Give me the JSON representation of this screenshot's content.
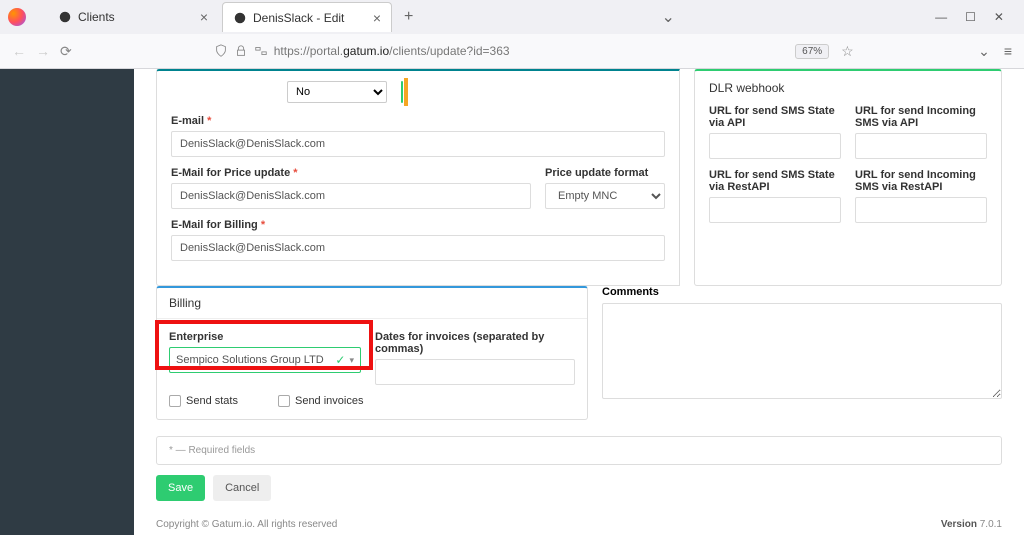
{
  "tabs": [
    {
      "title": "Clients"
    },
    {
      "title": "DenisSlack - Edit"
    }
  ],
  "url": {
    "prefix": "https://portal.",
    "domain": "gatum.io",
    "path": "/clients/update?id=363"
  },
  "zoom": "67%",
  "top_select": "No",
  "email_label": "E-mail",
  "email_value": "DenisSlack@DenisSlack.com",
  "price_email_label": "E-Mail for Price update",
  "price_email_value": "DenisSlack@DenisSlack.com",
  "price_format_label": "Price update format",
  "price_format_value": "Empty MNC",
  "billing_email_label": "E-Mail for Billing",
  "billing_email_value": "DenisSlack@DenisSlack.com",
  "webhook": {
    "title": "DLR webhook",
    "url_sms_api": "URL for send SMS State via API",
    "url_incoming_api": "URL for send Incoming SMS via API",
    "url_sms_rest": "URL for send SMS State via RestAPI",
    "url_incoming_rest": "URL for send Incoming SMS via RestAPI"
  },
  "billing": {
    "header": "Billing",
    "enterprise_label": "Enterprise",
    "enterprise_value": "Sempico Solutions Group LTD",
    "dates_label": "Dates for invoices (separated by commas)",
    "send_stats": "Send stats",
    "send_invoices": "Send invoices"
  },
  "comments_label": "Comments",
  "required_note": "* — Required fields",
  "save_label": "Save",
  "cancel_label": "Cancel",
  "footer_copy": "Copyright © Gatum.io. All rights reserved",
  "footer_version_label": "Version ",
  "footer_version": "7.0.1"
}
